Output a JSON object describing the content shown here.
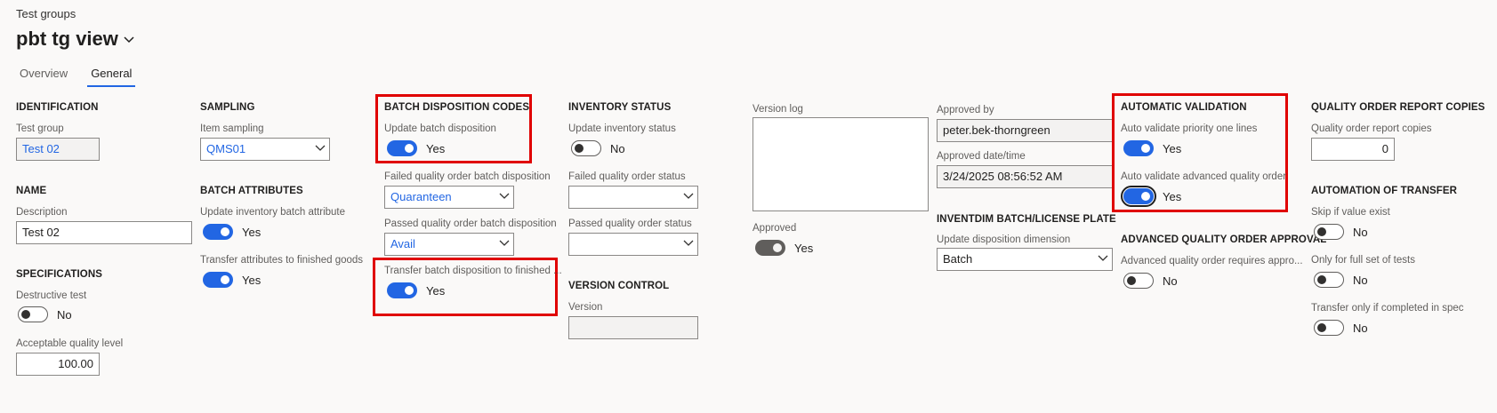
{
  "breadcrumb": "Test groups",
  "title": "pbt tg view",
  "tabs": [
    "Overview",
    "General"
  ],
  "identification": {
    "header": "IDENTIFICATION",
    "test_group_label": "Test group",
    "test_group_value": "Test 02"
  },
  "name": {
    "header": "NAME",
    "description_label": "Description",
    "description_value": "Test 02"
  },
  "specifications": {
    "header": "SPECIFICATIONS",
    "destructive_label": "Destructive test",
    "destructive_value": "No",
    "aql_label": "Acceptable quality level",
    "aql_value": "100.00"
  },
  "sampling": {
    "header": "SAMPLING",
    "item_sampling_label": "Item sampling",
    "item_sampling_value": "QMS01"
  },
  "batch_attributes": {
    "header": "BATCH ATTRIBUTES",
    "update_label": "Update inventory batch attribute",
    "update_value": "Yes",
    "transfer_label": "Transfer attributes to finished goods",
    "transfer_value": "Yes"
  },
  "batch_disposition": {
    "header": "BATCH DISPOSITION CODES",
    "update_label": "Update batch disposition",
    "update_value": "Yes",
    "failed_label": "Failed quality order batch disposition",
    "failed_value": "Quaranteen",
    "passed_label": "Passed quality order batch disposition",
    "passed_value": "Avail",
    "transfer_label": "Transfer batch disposition to finished ...",
    "transfer_value": "Yes"
  },
  "inventory_status": {
    "header": "INVENTORY STATUS",
    "update_label": "Update inventory status",
    "update_value": "No",
    "failed_label": "Failed quality order status",
    "failed_value": "",
    "passed_label": "Passed quality order status",
    "passed_value": ""
  },
  "version_control": {
    "header": "VERSION CONTROL",
    "version_label": "Version",
    "version_value": ""
  },
  "version_log": {
    "label": "Version log",
    "value": "",
    "approved_label": "Approved",
    "approved_value": "Yes"
  },
  "approval": {
    "approved_by_label": "Approved by",
    "approved_by_value": "peter.bek-thorngreen",
    "approved_date_label": "Approved date/time",
    "approved_date_value": "3/24/2025 08:56:52 AM"
  },
  "inventdim": {
    "header": "INVENTDIM BATCH/LICENSE PLATE",
    "update_label": "Update disposition dimension",
    "update_value": "Batch"
  },
  "auto_validation": {
    "header": "AUTOMATIC VALIDATION",
    "priority_label": "Auto validate priority one lines",
    "priority_value": "Yes",
    "advanced_label": "Auto validate advanced quality order",
    "advanced_value": "Yes"
  },
  "advanced_approval": {
    "header": "ADVANCED QUALITY ORDER APPROVAL",
    "requires_label": "Advanced quality order requires appro...",
    "requires_value": "No"
  },
  "report_copies": {
    "header": "QUALITY ORDER REPORT COPIES",
    "copies_label": "Quality order report copies",
    "copies_value": "0"
  },
  "automation_transfer": {
    "header": "AUTOMATION OF TRANSFER",
    "skip_label": "Skip if value exist",
    "skip_value": "No",
    "full_label": "Only for full set of tests",
    "full_value": "No",
    "spec_label": "Transfer only if completed in spec",
    "spec_value": "No"
  },
  "colors": {
    "accent": "#2266e3",
    "highlight": "#e00000"
  }
}
